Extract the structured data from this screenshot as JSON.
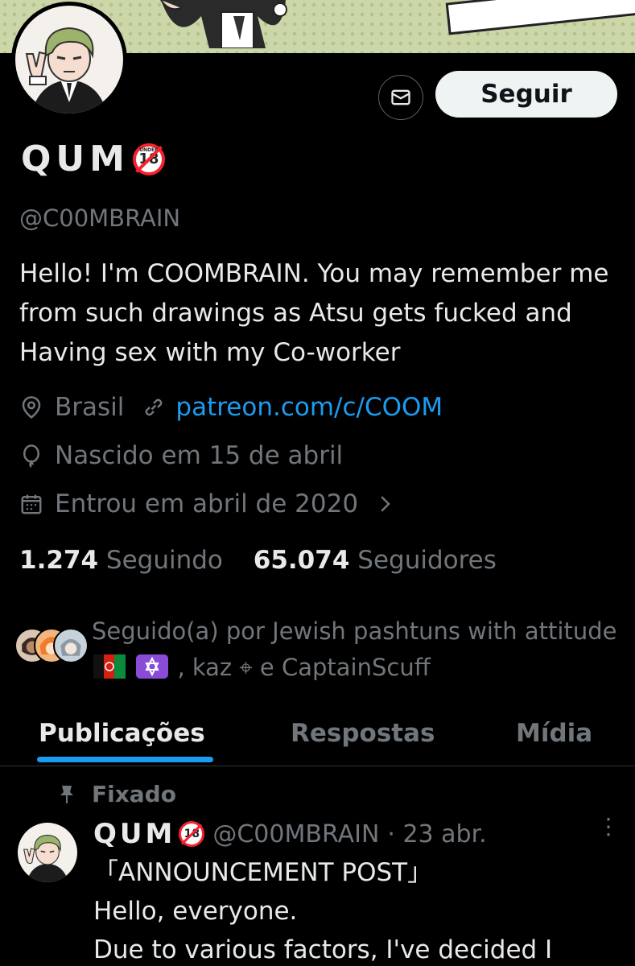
{
  "profile": {
    "display_name": "QUM",
    "badge_text": "18",
    "badge_under": "UNDER",
    "handle": "@C00MBRAIN",
    "bio": "Hello! I'm COOMBRAIN. You may remember me from such drawings as Atsu gets fucked and Having sex with my Co-worker",
    "location": "Brasil",
    "link": "patreon.com/c/COOM",
    "birthday": "Nascido em 15 de abril",
    "joined": "Entrou em abril de 2020",
    "following_count": "1.274",
    "following_label": "Seguindo",
    "followers_count": "65.074",
    "followers_label": "Seguidores",
    "followed_by_prefix": "Seguido(a) por Jewish pashtuns with attitude",
    "followed_by_suffix": ", kaz ⌖ e CaptainScuff"
  },
  "actions": {
    "follow_label": "Seguir"
  },
  "tabs": [
    {
      "label": "Publicações",
      "active": true
    },
    {
      "label": "Respostas",
      "active": false
    },
    {
      "label": "Mídia",
      "active": false
    }
  ],
  "pinned_post": {
    "pinned_label": "Fixado",
    "author_name": "QUM",
    "author_handle": "@C00MBRAIN",
    "date": "· 23 abr.",
    "text_lines": [
      "「ANNOUNCEMENT POST」",
      "Hello, everyone.",
      "Due to various factors, I've decided I"
    ]
  },
  "icons": {
    "message": "envelope-icon",
    "location": "location-pin-icon",
    "link": "link-icon",
    "birthday": "balloon-icon",
    "joined": "calendar-icon",
    "pin": "pin-icon",
    "more": "more-vertical-icon"
  },
  "colors": {
    "accent": "#1d9bf0",
    "text": "#e7e9ea",
    "secondary": "#71767b",
    "background": "#000000"
  }
}
